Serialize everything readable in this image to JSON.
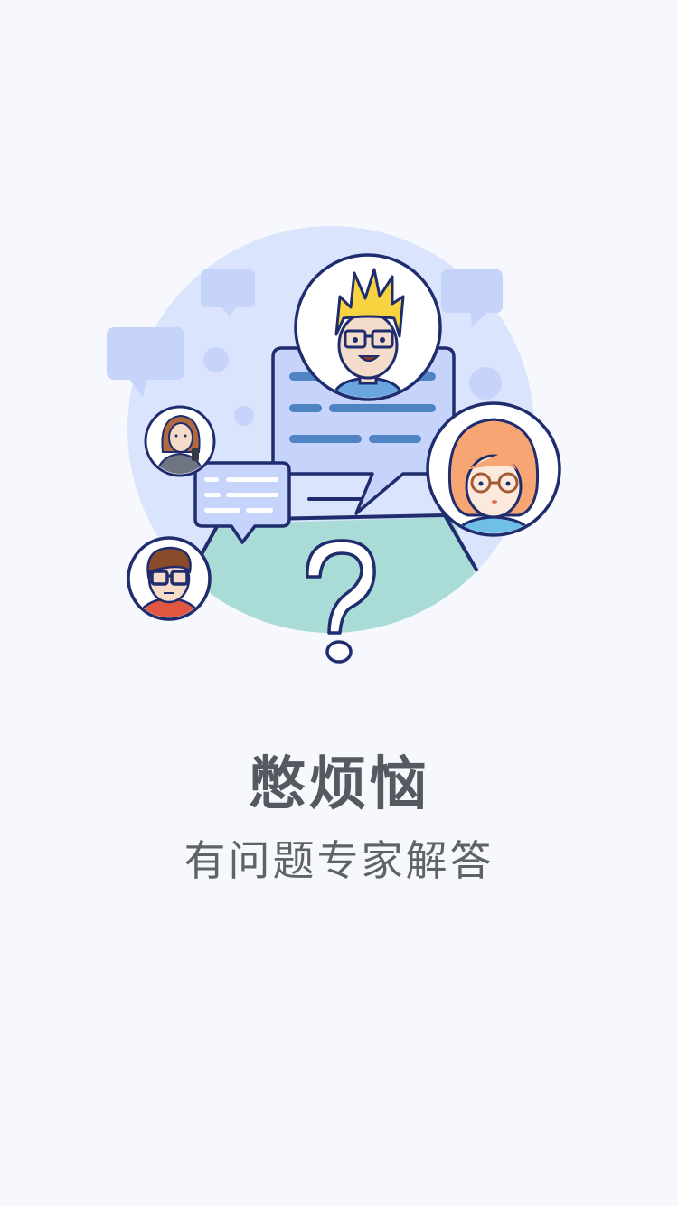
{
  "onboarding": {
    "headline": "憋烦恼",
    "subline": "有问题专家解答"
  },
  "illustration": {
    "icons": [
      "expert-avatar-icon",
      "chat-bubble-icon",
      "question-mark-icon"
    ],
    "colors": {
      "background": "#f6f8fd",
      "circle": "#dae4fd",
      "bubble": "#c6d3fa",
      "outline": "#1f2d6e",
      "teal": "#a9dcd6",
      "chat_line": "#4e83c4",
      "hair_yellow": "#f7d43f",
      "hair_orange": "#f7a673"
    }
  }
}
